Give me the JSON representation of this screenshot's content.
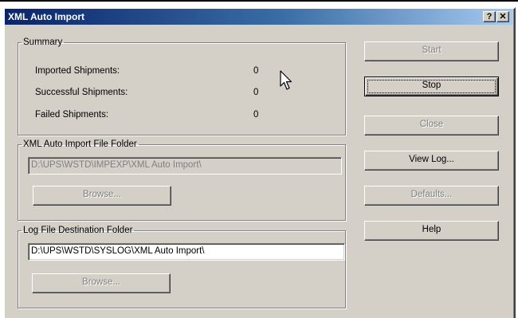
{
  "window": {
    "title": "XML Auto Import",
    "help_glyph": "?",
    "close_glyph": "✕"
  },
  "summary": {
    "legend": "Summary",
    "rows": [
      {
        "label": "Imported Shipments:",
        "value": "0"
      },
      {
        "label": "Successful Shipments:",
        "value": "0"
      },
      {
        "label": "Failed Shipments:",
        "value": "0"
      }
    ]
  },
  "import_folder": {
    "legend": "XML Auto Import File Folder",
    "path": "D:\\UPS\\WSTD\\IMPEXP\\XML Auto Import\\",
    "browse_label": "Browse...",
    "enabled": false
  },
  "log_folder": {
    "legend": "Log File Destination Folder",
    "path": "D:\\UPS\\WSTD\\SYSLOG\\XML Auto Import\\",
    "browse_label": "Browse...",
    "enabled": true
  },
  "buttons": {
    "start": {
      "label": "Start",
      "enabled": false
    },
    "stop": {
      "label": "Stop",
      "enabled": true
    },
    "close": {
      "label": "Close",
      "enabled": false
    },
    "view_log": {
      "label": "View Log...",
      "enabled": true
    },
    "defaults": {
      "label": "Defaults...",
      "enabled": false
    },
    "help": {
      "label": "Help",
      "enabled": true
    }
  },
  "icons": {
    "cursor": "arrow-cursor-icon"
  },
  "colors": {
    "title_gradient_start": "#0a246a",
    "title_gradient_end": "#a6caf0",
    "face": "#d4d0c8",
    "disabled_text": "#808080"
  }
}
